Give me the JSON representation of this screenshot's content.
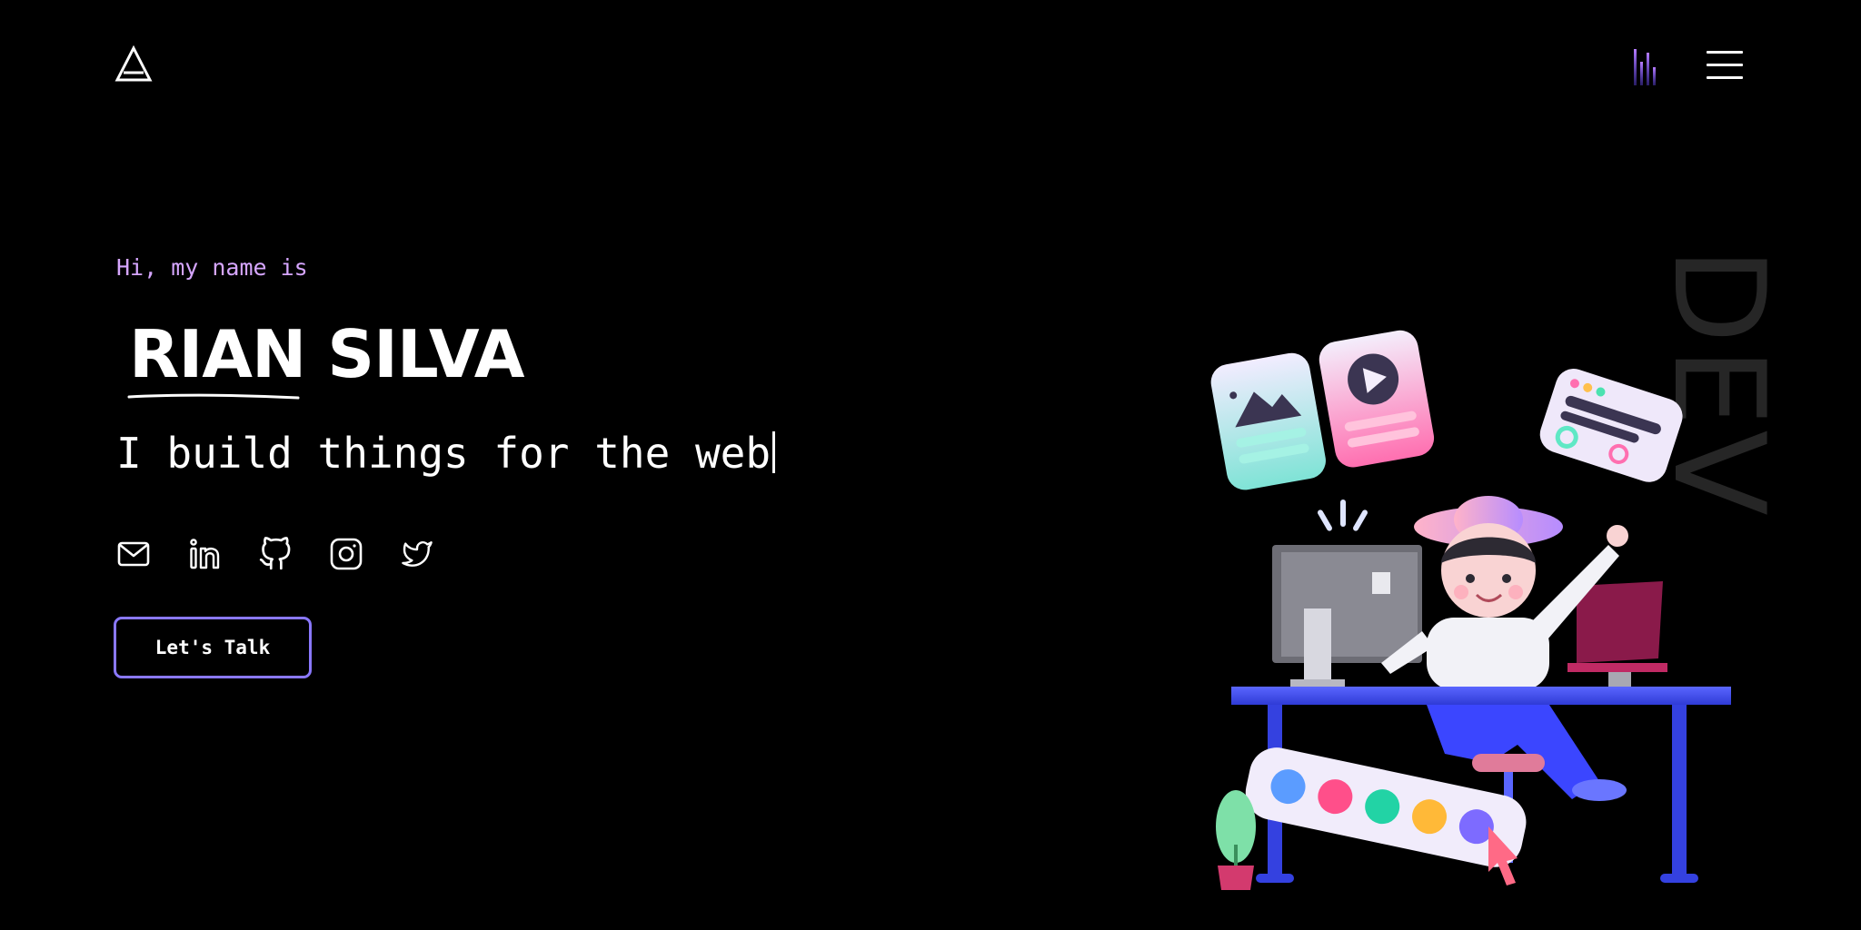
{
  "header": {
    "logo_icon": "triangle-logo-icon",
    "audio_icon": "audio-bars-icon",
    "menu_icon": "hamburger-menu-icon"
  },
  "hero": {
    "greeting": "Hi, my name is",
    "name": "RIAN SILVA",
    "tagline": "I build things for the web",
    "cta_label": "Let's Talk"
  },
  "socials": [
    {
      "icon": "mail-icon"
    },
    {
      "icon": "linkedin-icon"
    },
    {
      "icon": "github-icon"
    },
    {
      "icon": "instagram-icon"
    },
    {
      "icon": "twitter-icon"
    }
  ],
  "decor": {
    "vertical_word": "DEV"
  },
  "colors": {
    "background": "#000000",
    "accent_purple": "#d6a6ff",
    "button_border": "#8a78ff"
  }
}
